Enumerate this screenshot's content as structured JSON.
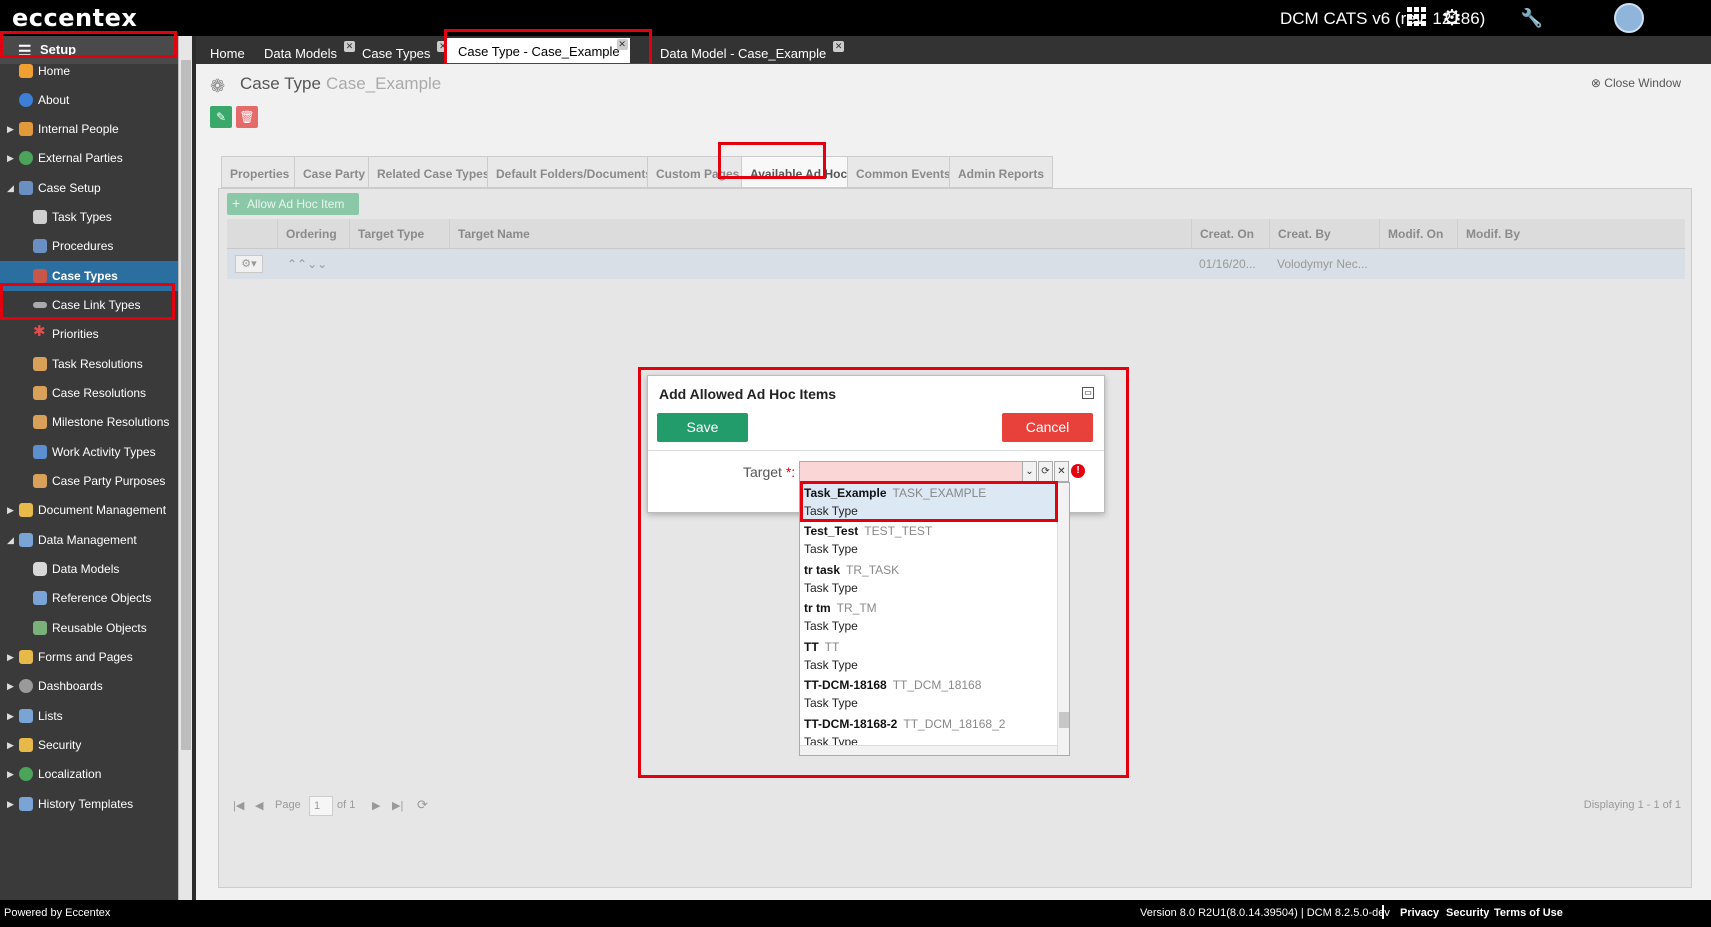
{
  "header": {
    "logo": "eccentex",
    "app_title": "DCM CATS v6 (rev. 12186)",
    "icons": [
      "grid-icon",
      "gear-icon",
      "avatar",
      "wrench-icon"
    ]
  },
  "sidebar": {
    "title": "Setup",
    "items": [
      {
        "label": "Home",
        "icon": "home-icon"
      },
      {
        "label": "About",
        "icon": "info-icon"
      },
      {
        "label": "Internal People",
        "icon": "people-icon"
      },
      {
        "label": "External Parties",
        "icon": "globe-icon"
      },
      {
        "label": "Case Setup",
        "icon": "tree-icon"
      },
      {
        "label": "Task Types",
        "icon": "cube-icon"
      },
      {
        "label": "Procedures",
        "icon": "tree-icon"
      },
      {
        "label": "Case Types",
        "icon": "case-icon"
      },
      {
        "label": "Case Link Types",
        "icon": "link-icon"
      },
      {
        "label": "Priorities",
        "icon": "asterisk-icon"
      },
      {
        "label": "Task Resolutions",
        "icon": "tag-icon"
      },
      {
        "label": "Case Resolutions",
        "icon": "tag-icon"
      },
      {
        "label": "Milestone Resolutions",
        "icon": "tag-icon"
      },
      {
        "label": "Work Activity Types",
        "icon": "monitor-icon"
      },
      {
        "label": "Case Party Purposes",
        "icon": "tag-icon"
      },
      {
        "label": "Document Management",
        "icon": "folder-icon"
      },
      {
        "label": "Data Management",
        "icon": "table-icon"
      },
      {
        "label": "Data Models",
        "icon": "database-icon"
      },
      {
        "label": "Reference Objects",
        "icon": "table-icon"
      },
      {
        "label": "Reusable Objects",
        "icon": "table-icon"
      },
      {
        "label": "Forms and Pages",
        "icon": "form-icon"
      },
      {
        "label": "Dashboards",
        "icon": "dashboard-icon"
      },
      {
        "label": "Lists",
        "icon": "list-icon"
      },
      {
        "label": "Security",
        "icon": "lock-icon"
      },
      {
        "label": "Localization",
        "icon": "globe-icon"
      },
      {
        "label": "History Templates",
        "icon": "history-icon"
      }
    ]
  },
  "tabs": [
    "Home",
    "Data Models",
    "Case Types",
    "Case Type - Case_Example",
    "Data Model - Case_Example"
  ],
  "page": {
    "title": "Case Type",
    "subtitle": "Case_Example",
    "close_window": "Close Window"
  },
  "content_tabs": [
    "Properties",
    "Case Party",
    "Related Case Types",
    "Default Folders/Documents",
    "Custom Pages",
    "Available Ad Hoc",
    "Common Events",
    "Admin Reports"
  ],
  "grid": {
    "allow_button": "Allow Ad Hoc Item",
    "columns": [
      "Ordering",
      "Target Type",
      "Target Name",
      "Creat. On",
      "Creat. By",
      "Modif. On",
      "Modif. By"
    ],
    "row": {
      "ordering_arrows": "⌃⌃⌄⌄",
      "created_on": "01/16/20...",
      "created_by": "Volodymyr Nec..."
    },
    "pager": {
      "page_label": "Page",
      "page_value": "1",
      "of_label": "of 1",
      "displaying": "Displaying 1 - 1 of 1"
    }
  },
  "dialog": {
    "title": "Add Allowed Ad Hoc Items",
    "save": "Save",
    "cancel": "Cancel",
    "target_label": "Target",
    "required_mark": "*:",
    "options": [
      {
        "name": "Task_Example",
        "code": "TASK_EXAMPLE",
        "type": "Task Type"
      },
      {
        "name": "Test_Test",
        "code": "TEST_TEST",
        "type": "Task Type"
      },
      {
        "name": "tr task",
        "code": "TR_TASK",
        "type": "Task Type"
      },
      {
        "name": "tr tm",
        "code": "TR_TM",
        "type": "Task Type"
      },
      {
        "name": "TT",
        "code": "TT",
        "type": "Task Type"
      },
      {
        "name": "TT-DCM-18168",
        "code": "TT_DCM_18168",
        "type": "Task Type"
      },
      {
        "name": "TT-DCM-18168-2",
        "code": "TT_DCM_18168_2",
        "type": "Task Type"
      }
    ]
  },
  "footer": {
    "powered": "Powered by Eccentex",
    "version": "Version 8.0 R2U1(8.0.14.39504) | DCM 8.2.5.0-dev",
    "links": [
      "Privacy",
      "Security",
      "Terms of Use"
    ]
  },
  "colors": {
    "highlight_red": "#e3000f",
    "save_green": "#229c6b",
    "cancel_red": "#e8413b",
    "active_blue": "#2a6fa0"
  }
}
